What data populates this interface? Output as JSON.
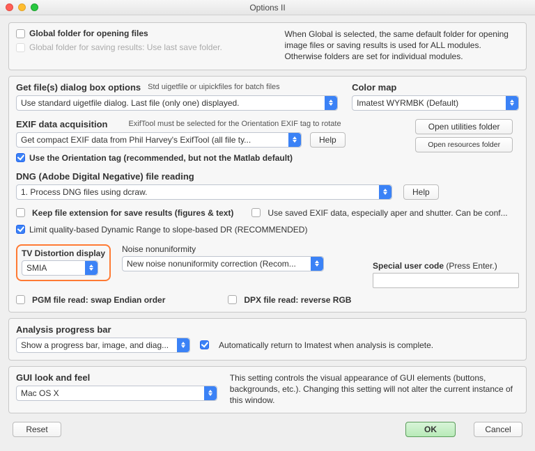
{
  "window": {
    "title": "Options II"
  },
  "panel1": {
    "cb_global_open": "Global folder for opening files",
    "cb_global_save": "Global folder for saving results: Use last save folder.",
    "description": "When Global is selected, the same default folder for opening image files or saving results is used for ALL modules. Otherwise folders are set for individual modules."
  },
  "panel2": {
    "getfile_label": "Get file(s) dialog box options",
    "getfile_sub": "Std uigetfile or uipickfiles for batch files",
    "getfile_select": "Use standard uigetfile dialog.  Last file (only one) displayed.",
    "colormap_label": "Color map",
    "colormap_select": "Imatest WYRMBK  (Default)",
    "exif_label": "EXIF data acquisition",
    "exif_sub": "ExifTool must be selected for the Orientation EXIF tag to rotate",
    "exif_select": "Get compact EXIF data from Phil Harvey's ExifTool (all file ty...",
    "help_btn": "Help",
    "open_util_btn": "Open utilities folder",
    "open_res_btn": "Open resources  folder",
    "cb_orientation": "Use the Orientation tag (recommended, but not the Matlab default)",
    "dng_label": "DNG (Adobe Digital Negative) file reading",
    "dng_select": "1. Process DNG files using dcraw.",
    "dng_help_btn": "Help",
    "cb_keep_ext": "Keep file extension for save results (figures & text)",
    "cb_use_saved": "Use saved EXIF data, especially aper and shutter. Can be conf...",
    "cb_limit_dr": "Limit quality-based Dynamic Range to slope-based DR  (RECOMMENDED)",
    "tv_label": "TV Distortion display",
    "tv_select": "SMIA",
    "noise_label": "Noise nonuniformity",
    "noise_select": "New noise nonuniformity correction (Recom...",
    "usercode_label": "Special user code",
    "usercode_hint": "(Press Enter.)",
    "cb_pgm": "PGM file read: swap Endian order",
    "cb_dpx": "DPX file read: reverse RGB"
  },
  "panel3": {
    "prog_label": "Analysis progress bar",
    "prog_select": "Show a progress bar, image, and diag...",
    "cb_auto": "Automatically return to Imatest when analysis is complete."
  },
  "panel4": {
    "gui_label": "GUI look and feel",
    "gui_select": "Mac OS X",
    "gui_desc": "This setting controls the visual appearance of GUI elements (buttons, backgrounds, etc.).  Changing this setting will not alter the current instance of this window."
  },
  "footer": {
    "reset": "Reset",
    "ok": "OK",
    "cancel": "Cancel"
  }
}
